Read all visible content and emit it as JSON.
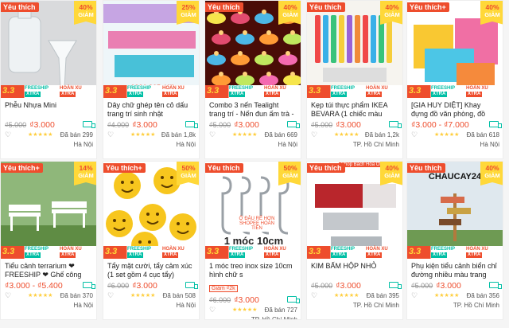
{
  "promo": {
    "mark": "3.3",
    "freeship_line1": "FREESHIP",
    "freeship_line2": "XTRA",
    "hoanxu_line1": "HOÀN XU",
    "hoanxu_line2": "XTRA"
  },
  "labels": {
    "sold_prefix": "Đã bán",
    "discount_suffix": "GIẢM",
    "stars": "★★★★★",
    "heart": "♡",
    "minus": "−"
  },
  "products": [
    {
      "fav": "Yêu thích",
      "discount": "40%",
      "name": "Phễu Nhựa Mini",
      "old_price": "₫5.000",
      "price": "₫3.000",
      "sold": "299",
      "location": "Hà Nội",
      "thumb": "funnel"
    },
    {
      "fav": "",
      "discount": "25%",
      "name": "Dây chữ ghép tên cỏ dấu trang trí sinh nhật",
      "old_price": "₫4.000",
      "price": "₫3.000",
      "sold": "1,8k",
      "location": "Hà Nội",
      "thumb": "banner",
      "thumb_text": "0936.265.466"
    },
    {
      "fav": "Yêu thích",
      "discount": "40%",
      "name": "Combo 3 nến Tealight trang trí - Nến đun ấm trà - Nến đốt đèn ...",
      "old_price": "₫5.000",
      "price": "₫3.000",
      "sold": "669",
      "location": "Hà Nội",
      "thumb": "candles"
    },
    {
      "fav": "Yêu thích",
      "discount": "40%",
      "name": "Kẹp túi thực phẩm IKEA BEVARA (1 chiếc màu ngẫu ...",
      "old_price": "₫5.000",
      "price": "₫3.000",
      "sold": "1,2k",
      "location": "TP. Hồ Chí Minh",
      "thumb": "clips"
    },
    {
      "fav": "Yêu thích+",
      "discount": "40%",
      "name": "[GIA HUY DIỆT] Khay đựng đồ văn phòng, đồ dùng học sinh ...",
      "old_price": "",
      "price": "₫3.000 - ₫7.000",
      "sold": "618",
      "location": "Hà Nội",
      "thumb": "baskets"
    },
    {
      "fav": "Yêu thích+",
      "discount": "14%",
      "name": "Tiểu cảnh terrarium ❤ FREESHIP ❤ Ghế công viê...",
      "old_price": "",
      "price": "₫3.000 - ₫5.400",
      "sold": "370",
      "location": "Hà Nội",
      "thumb": "bench"
    },
    {
      "fav": "Yêu thích+",
      "discount": "50%",
      "name": "Tẩy mặt cười, tẩy cảm xúc (1 set gồm 4 cục tẩy)",
      "old_price": "₫6.000",
      "price": "₫3.000",
      "sold": "508",
      "location": "Hà Nội",
      "thumb": "emoji"
    },
    {
      "fav": "Yêu thích",
      "discount": "50%",
      "name": "1 móc treo inox size 10cm hình chữ s",
      "old_price": "₫6.000",
      "price": "₫3.000",
      "sold": "727",
      "location": "TP. Hồ Chí Minh",
      "tag": "Giảm ₫2k",
      "thumb": "hooks",
      "thumb_text": "1 móc 10cm",
      "ship_text": "Ở ĐÂU RẺ HƠN SHOPEE HOÀN TIỀN"
    },
    {
      "fav": "Yêu thích",
      "discount": "40%",
      "name": "KIM BẤM HỘP NHỎ",
      "old_price": "₫5.000",
      "price": "₫3.000",
      "sold": "395",
      "location": "TP. Hồ Chí Minh",
      "thumb": "staples",
      "banner": "Shop Bách Hóa Online"
    },
    {
      "fav": "Yêu thích",
      "discount": "40%",
      "name": "Phụ kiện tiểu cảnh biển chỉ đường nhiều màu trang trí,...",
      "old_price": "₫5.000",
      "price": "₫3.000",
      "sold": "356",
      "location": "TP. Hồ Chí Minh",
      "thumb": "signs",
      "thumb_text": "CHAUCAY24"
    }
  ]
}
